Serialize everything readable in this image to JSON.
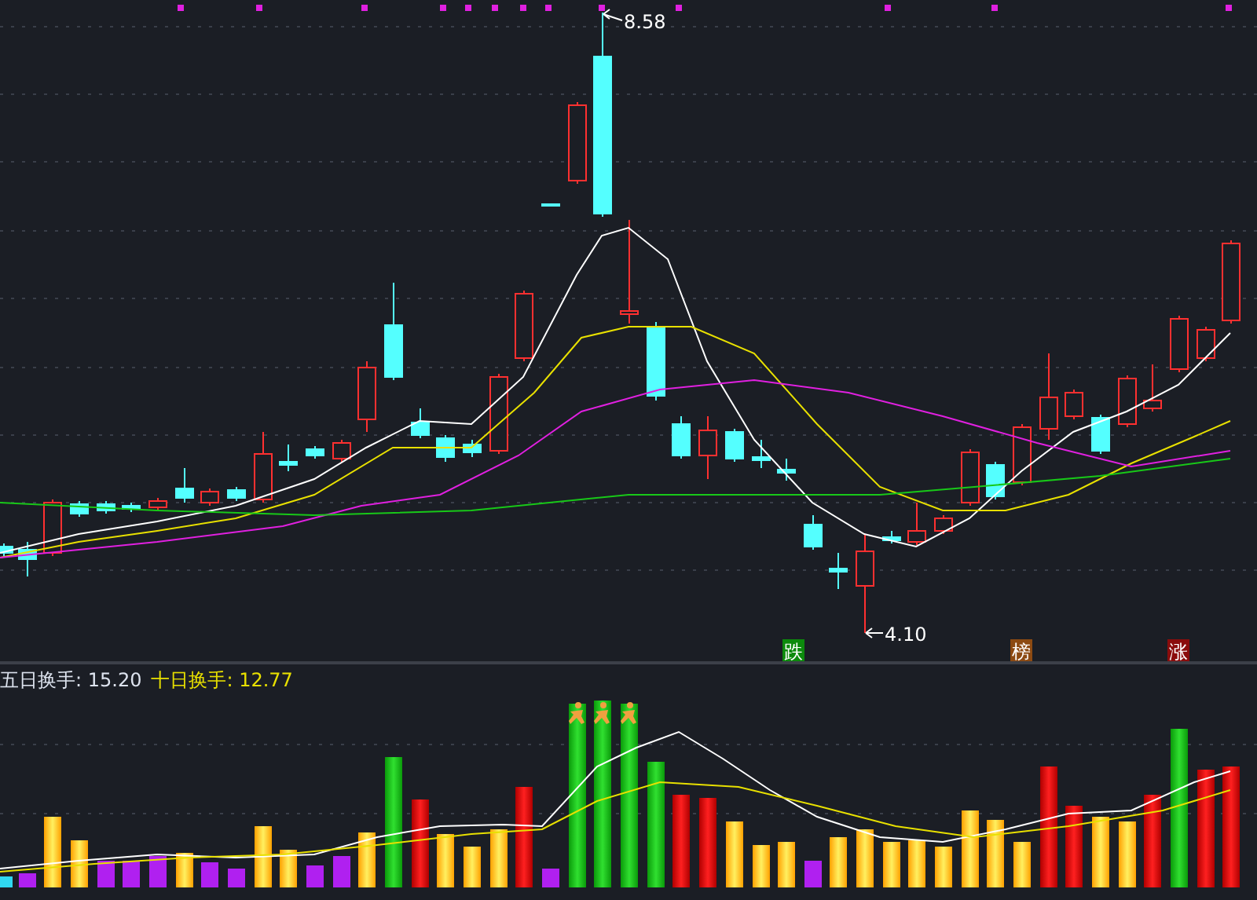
{
  "price_chart": {
    "high_label": "8.58",
    "low_label": "4.10",
    "markers": [
      {
        "text": "跌",
        "color": "#0c8a0c"
      },
      {
        "text": "榜",
        "color": "#8c4a12"
      },
      {
        "text": "涨",
        "color": "#8a0c0c"
      }
    ]
  },
  "volume_panel": {
    "indicators": [
      {
        "label": "五日换手: 15.20",
        "color": "#dde3ee"
      },
      {
        "label": "十日换手: 12.77",
        "color": "#e8e000"
      }
    ]
  }
}
